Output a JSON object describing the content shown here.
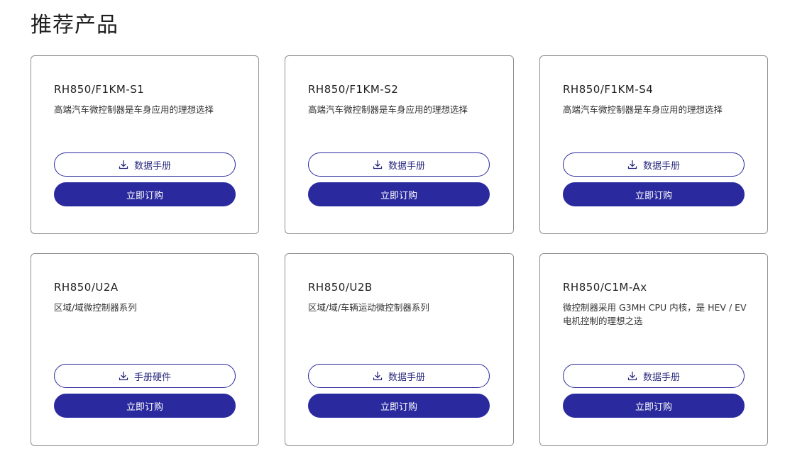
{
  "section": {
    "title": "推荐产品"
  },
  "colors": {
    "accent": "#2a2a9e",
    "border": "#8f8f8f"
  },
  "products": [
    {
      "name": "RH850/F1KM-S1",
      "desc": "高端汽车微控制器是车身应用的理想选择",
      "doc_label": "数据手册",
      "doc_icon": "download-icon",
      "buy_label": "立即订购"
    },
    {
      "name": "RH850/F1KM-S2",
      "desc": "高端汽车微控制器是车身应用的理想选择",
      "doc_label": "数据手册",
      "doc_icon": "download-icon",
      "buy_label": "立即订购"
    },
    {
      "name": "RH850/F1KM-S4",
      "desc": "高端汽车微控制器是车身应用的理想选择",
      "doc_label": "数据手册",
      "doc_icon": "download-icon",
      "buy_label": "立即订购"
    },
    {
      "name": "RH850/U2A",
      "desc": "区域/域微控制器系列",
      "doc_label": "手册硬件",
      "doc_icon": "download-icon",
      "buy_label": "立即订购"
    },
    {
      "name": "RH850/U2B",
      "desc": "区域/域/车辆运动微控制器系列",
      "doc_label": "数据手册",
      "doc_icon": "download-icon",
      "buy_label": "立即订购"
    },
    {
      "name": "RH850/C1M-Ax",
      "desc": "微控制器采用 G3MH CPU 内核，是 HEV / EV 电机控制的理想之选",
      "doc_label": "数据手册",
      "doc_icon": "download-icon",
      "buy_label": "立即订购"
    }
  ]
}
